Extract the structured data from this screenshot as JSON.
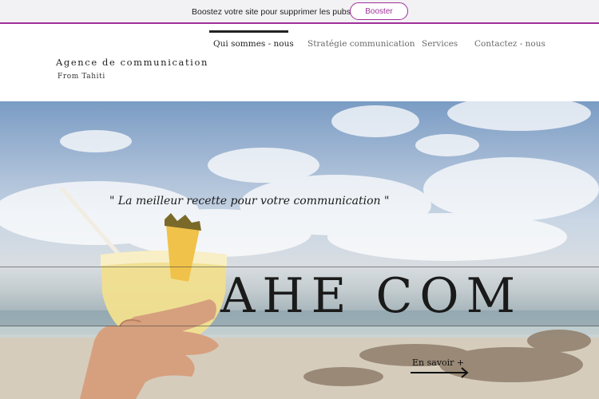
{
  "promo": {
    "text": "Boostez votre site pour supprimer les pubs Wix",
    "button_label": "Booster",
    "accent_color": "#a0309a"
  },
  "nav": {
    "items": [
      {
        "label": "Qui sommes - nous",
        "active": true
      },
      {
        "label": "Stratégie communication",
        "active": false
      },
      {
        "label": "Services",
        "active": false
      },
      {
        "label": "Contactez - nous",
        "active": false
      }
    ]
  },
  "brand": {
    "title": "Agence de communication",
    "subtitle": "From Tahiti"
  },
  "hero": {
    "quote": "\" La meilleur recette pour votre communication \"",
    "title": "AHE COM",
    "cta_label": "En savoir +",
    "cta_icon": "arrow-right-icon"
  }
}
